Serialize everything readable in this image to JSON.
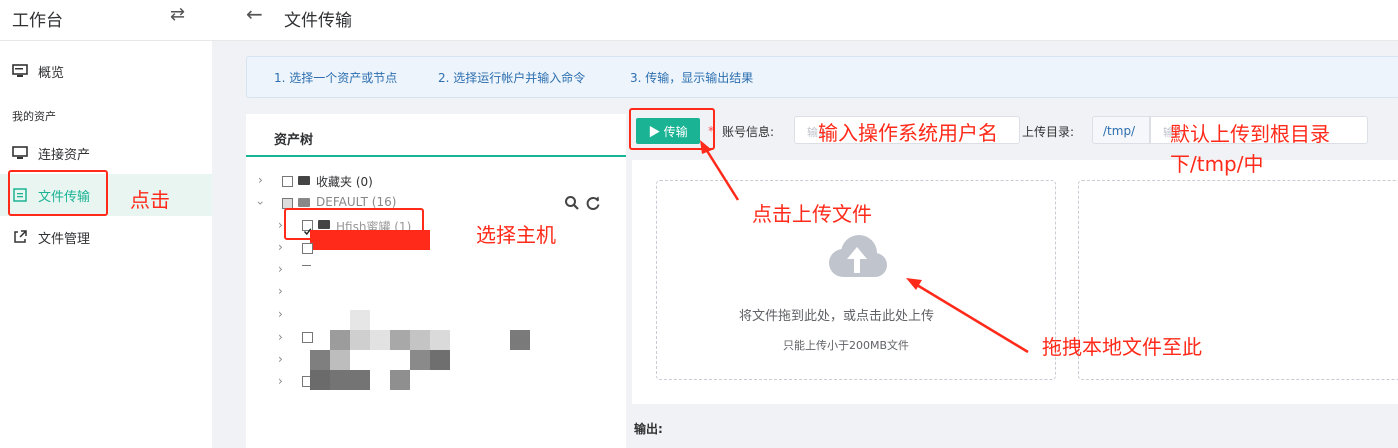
{
  "sidebar": {
    "title": "工作台",
    "items": [
      {
        "label": "概览"
      },
      {
        "label": "连接资产"
      },
      {
        "label": "文件传输",
        "active": true
      },
      {
        "label": "文件管理"
      }
    ],
    "group_label": "我的资产"
  },
  "header": {
    "title": "文件传输"
  },
  "steps": [
    "1. 选择一个资产或节点",
    "2. 选择运行帐户并输入命令",
    "3. 传输，显示输出结果"
  ],
  "tree": {
    "title": "资产树",
    "nodes": [
      {
        "label": "收藏夹 (0)"
      },
      {
        "label": "DEFAULT (16)"
      },
      {
        "label": "Hfish蜜罐 (1)"
      }
    ]
  },
  "toolbar": {
    "run_label": "传输",
    "account_label": "账号信息:",
    "account_placeholder": "输入",
    "upload_dir_label": "上传目录:",
    "upload_dir_prefix": "/tmp/",
    "upload_dir_placeholder": "输入"
  },
  "upload": {
    "hint": "将文件拖到此处，或点击此处上传",
    "limit": "只能上传小于200MB文件"
  },
  "output": {
    "label": "输出:"
  },
  "annotations": {
    "click": "点击",
    "select_host": "选择主机",
    "click_upload": "点击上传文件",
    "enter_user": "输入操作系统用户名",
    "default_dir_1": "默认上传到根目录",
    "default_dir_2": "下/tmp/中",
    "drag_local": "拖拽本地文件至此"
  },
  "colors": {
    "accent": "#1ab394",
    "annotation": "#ff2a1a",
    "step_text": "#2d6fb0"
  }
}
